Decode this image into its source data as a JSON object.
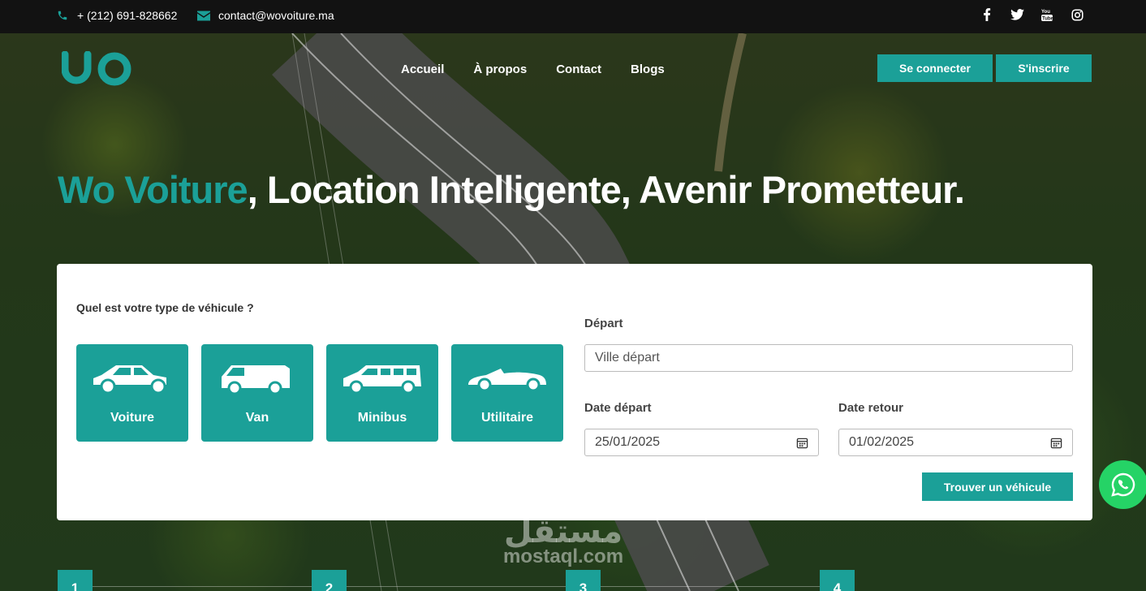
{
  "topbar": {
    "phone": "+ (212) 691-828662",
    "email": "contact@wovoiture.ma",
    "socials": [
      "facebook-icon",
      "twitter-icon",
      "youtube-icon",
      "instagram-icon"
    ]
  },
  "header": {
    "logo_text": "wo",
    "nav": [
      "Accueil",
      "À propos",
      "Contact",
      "Blogs"
    ],
    "login_label": "Se connecter",
    "signup_label": "S'inscrire"
  },
  "hero": {
    "brand": "Wo Voiture",
    "tagline": ", Location Intelligente, Avenir Prometteur."
  },
  "search": {
    "question": "Quel est votre type de véhicule ?",
    "vehicle_types": [
      "Voiture",
      "Van",
      "Minibus",
      "Utilitaire"
    ],
    "departure_label": "Départ",
    "departure_placeholder": "Ville départ",
    "date_depart_label": "Date départ",
    "date_depart_value": "25/01/2025",
    "date_retour_label": "Date retour",
    "date_retour_value": "01/02/2025",
    "submit_label": "Trouver un véhicule"
  },
  "watermark": {
    "arabic": "مستقل",
    "latin": "mostaql.com"
  },
  "steps": [
    "1",
    "2",
    "3",
    "4"
  ],
  "colors": {
    "accent": "#1ba098",
    "topbar": "#121212",
    "whatsapp": "#25d366"
  }
}
